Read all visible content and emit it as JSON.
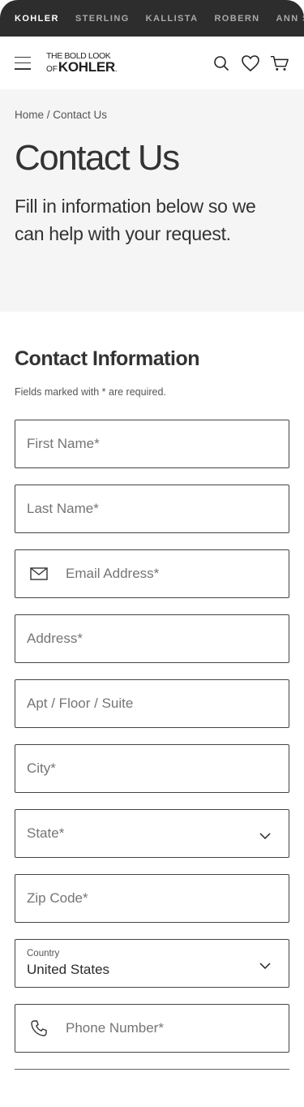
{
  "brands": [
    "KOHLER",
    "STERLING",
    "KALLISTA",
    "ROBERN",
    "ANN S"
  ],
  "header": {
    "logo_top": "THE BOLD LOOK",
    "logo_of": "OF",
    "logo_brand": "KOHLER",
    "logo_mark": "."
  },
  "hero": {
    "breadcrumb": "Home / Contact Us",
    "title": "Contact Us",
    "subtitle": "Fill in information below so we can help with your request."
  },
  "form": {
    "section_title": "Contact Information",
    "required_note": "Fields marked with * are required.",
    "first_name": "First Name*",
    "last_name": "Last Name*",
    "email": "Email Address*",
    "address": "Address*",
    "apt": "Apt / Floor / Suite",
    "city": "City*",
    "state": "State*",
    "zip": "Zip Code*",
    "country_label": "Country",
    "country_value": "United States",
    "phone": "Phone Number*"
  },
  "icons": {
    "menu": "hamburger-icon",
    "search": "search-icon",
    "favorites": "heart-icon",
    "cart": "cart-icon",
    "email": "envelope-icon",
    "phone": "phone-icon",
    "dropdown": "chevron-down-icon"
  },
  "colors": {
    "brand_bar": "#2d2d2d",
    "hero_bg": "#f5f5f5",
    "field_border": "#444444"
  }
}
